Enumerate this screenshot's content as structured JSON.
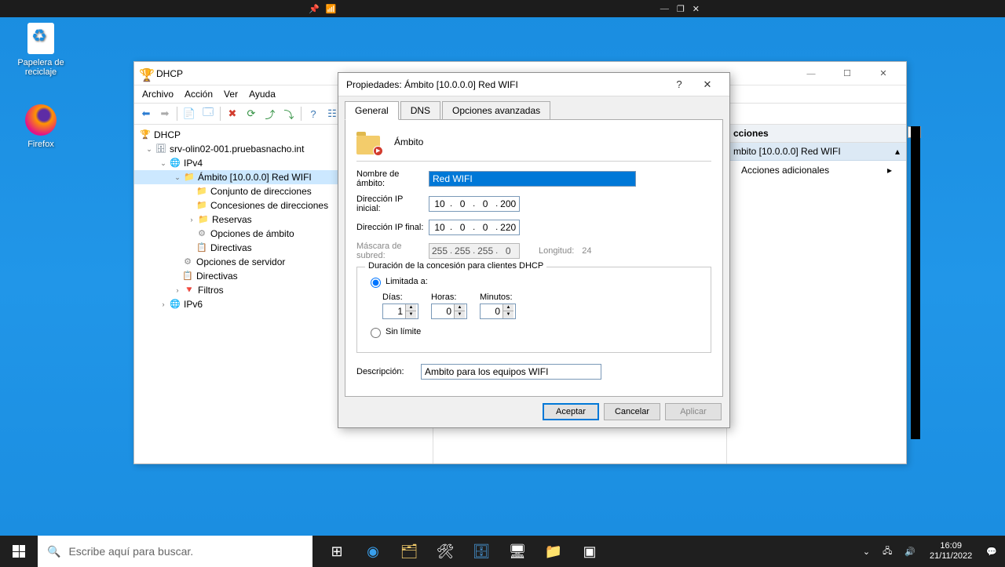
{
  "desktop": {
    "recycle_label": "Papelera de\nreciclaje",
    "firefox_label": "Firefox"
  },
  "dhcp_window": {
    "title": "DHCP",
    "menu": {
      "archivo": "Archivo",
      "accion": "Acción",
      "ver": "Ver",
      "ayuda": "Ayuda"
    },
    "tree": {
      "root": "DHCP",
      "server": "srv-olin02-001.pruebasnacho.int",
      "ipv4": "IPv4",
      "scope": "Ámbito [10.0.0.0] Red WIFI",
      "pool": "Conjunto de direcciones",
      "leases": "Concesiones de direcciones",
      "reservas": "Reservas",
      "scope_opts": "Opciones de ámbito",
      "directivas": "Directivas",
      "server_opts": "Opciones de servidor",
      "directivas2": "Directivas",
      "filtros": "Filtros",
      "ipv6": "IPv6"
    },
    "actions": {
      "header": "cciones",
      "scope_line": "mbito [10.0.0.0] Red WIFI",
      "additional": "Acciones adicionales"
    }
  },
  "props_dialog": {
    "title": "Propiedades: Ámbito [10.0.0.0] Red WIFI",
    "tabs": {
      "general": "General",
      "dns": "DNS",
      "advanced": "Opciones avanzadas"
    },
    "scope_label": "Ámbito",
    "name_label": "Nombre de ámbito:",
    "name_value": "Red WIFI",
    "ip_start_label": "Dirección IP inicial:",
    "ip_start": [
      "10",
      "0",
      "0",
      "200"
    ],
    "ip_end_label": "Dirección IP final:",
    "ip_end": [
      "10",
      "0",
      "0",
      "220"
    ],
    "mask_label": "Máscara de subred:",
    "mask": [
      "255",
      "255",
      "255",
      "0"
    ],
    "length_label": "Longitud:",
    "length_value": "24",
    "lease_legend": "Duración de la concesión para clientes DHCP",
    "limited_to": "Limitada a:",
    "days_label": "Días:",
    "hours_label": "Horas:",
    "minutes_label": "Minutos:",
    "days_value": "1",
    "hours_value": "0",
    "minutes_value": "0",
    "unlimited": "Sin límite",
    "desc_label": "Descripción:",
    "desc_value": "Ambito para los equipos WIFI",
    "btn_ok": "Aceptar",
    "btn_cancel": "Cancelar",
    "btn_apply": "Aplicar"
  },
  "taskbar": {
    "search_placeholder": "Escribe aquí para buscar.",
    "time": "16:09",
    "date": "21/11/2022"
  }
}
